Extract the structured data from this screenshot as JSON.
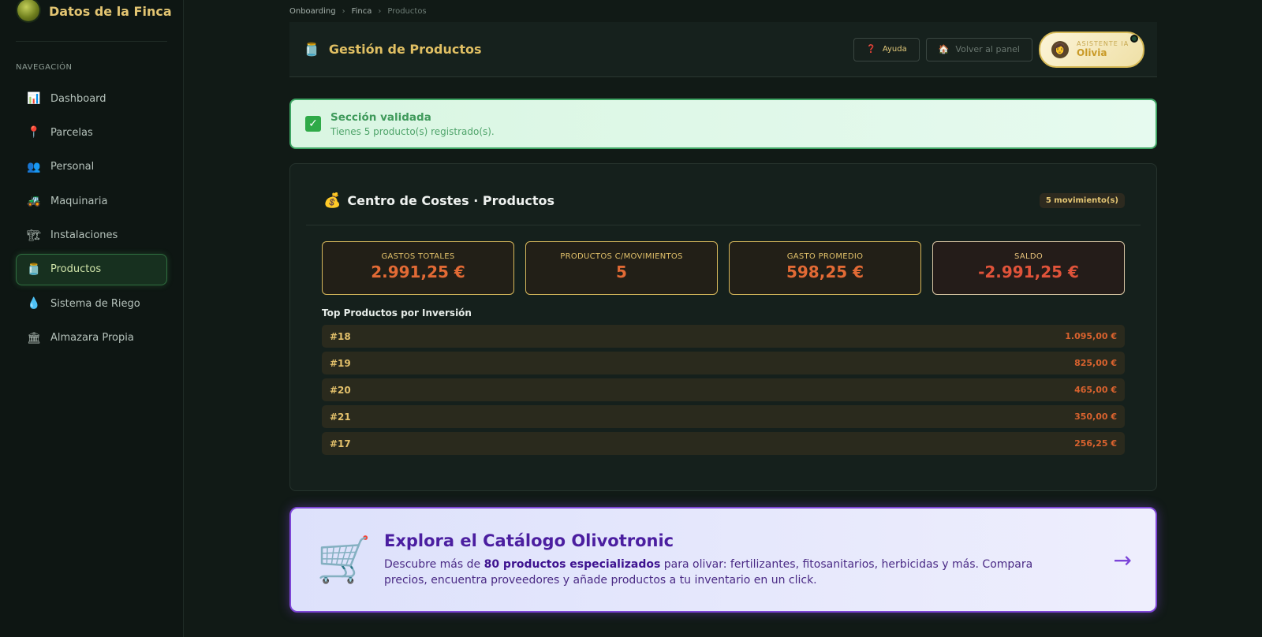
{
  "sidebar": {
    "brand_title": "Datos de la Finca",
    "nav_heading": "NAVEGACIÓN",
    "items": [
      {
        "label": "Dashboard",
        "icon": "📊"
      },
      {
        "label": "Parcelas",
        "icon": "📍"
      },
      {
        "label": "Personal",
        "icon": "👥"
      },
      {
        "label": "Maquinaria",
        "icon": "🚜"
      },
      {
        "label": "Instalaciones",
        "icon": "🏗"
      },
      {
        "label": "Productos",
        "icon": "🫙"
      },
      {
        "label": "Sistema de Riego",
        "icon": "💧"
      },
      {
        "label": "Almazara Propia",
        "icon": "🏛"
      }
    ]
  },
  "breadcrumb": {
    "items": [
      "Onboarding",
      "Finca",
      "Productos"
    ]
  },
  "header": {
    "title": "Gestión de Productos",
    "help_label": "Ayuda",
    "back_label": "Volver al panel",
    "assistant_small": "ASISTENTE IA",
    "assistant_name": "Olivia"
  },
  "alert": {
    "title": "Sección validada",
    "subtitle": "Tienes 5 producto(s) registrado(s)."
  },
  "costs": {
    "title": "Centro de Costes · Productos",
    "badge": "5 movimiento(s)",
    "stats": [
      {
        "label": "GASTOS TOTALES",
        "value": "2.991,25 €"
      },
      {
        "label": "PRODUCTOS C/MOVIMIENTOS",
        "value": "5"
      },
      {
        "label": "GASTO PROMEDIO",
        "value": "598,25 €"
      },
      {
        "label": "SALDO",
        "value": "-2.991,25 €"
      }
    ],
    "top_title": "Top Productos por Inversión",
    "top": [
      {
        "id": "#18",
        "amount": "1.095,00 €"
      },
      {
        "id": "#19",
        "amount": "825,00 €"
      },
      {
        "id": "#20",
        "amount": "465,00 €"
      },
      {
        "id": "#21",
        "amount": "350,00 €"
      },
      {
        "id": "#17",
        "amount": "256,25 €"
      }
    ]
  },
  "catalog": {
    "title": "Explora el Catálogo Olivotronic",
    "desc_pre": "Descubre más de ",
    "desc_bold": "80 productos especializados",
    "desc_post": " para olivar: fertilizantes, fitosanitarios, herbicidas y más. Compara precios, encuentra proveedores y añade productos a tu inventario en un click."
  }
}
